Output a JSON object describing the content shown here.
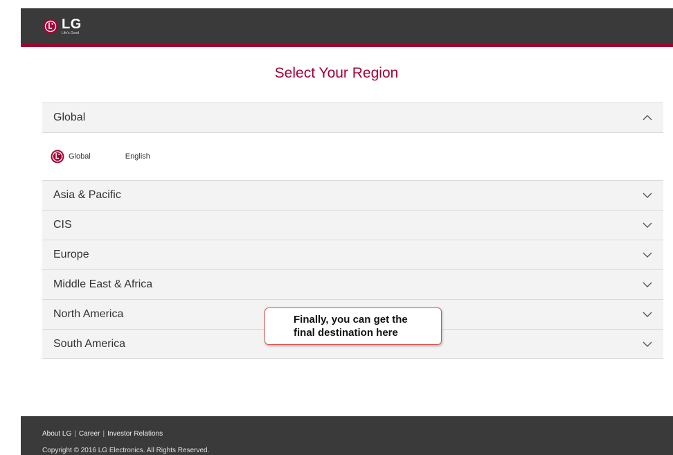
{
  "header": {
    "logo_text": "LG",
    "logo_tagline": "Life's Good",
    "brand_color": "#a50034"
  },
  "page": {
    "title": "Select Your Region"
  },
  "regions": [
    {
      "label": "Global",
      "expanded": true,
      "icon": "chevron-up-icon"
    },
    {
      "label": "Asia & Pacific",
      "expanded": false,
      "icon": "chevron-down-icon"
    },
    {
      "label": "CIS",
      "expanded": false,
      "icon": "chevron-down-icon"
    },
    {
      "label": "Europe",
      "expanded": false,
      "icon": "chevron-down-icon"
    },
    {
      "label": "Middle East & Africa",
      "expanded": false,
      "icon": "chevron-down-icon"
    },
    {
      "label": "North America",
      "expanded": false,
      "icon": "chevron-down-icon"
    },
    {
      "label": "South America",
      "expanded": false,
      "icon": "chevron-down-icon"
    }
  ],
  "global_sites": [
    {
      "site": "Global",
      "language": "English",
      "icon": "lg-logo-icon"
    }
  ],
  "callout": {
    "line1": "Finally, you can get the",
    "line2": "final destination here"
  },
  "footer": {
    "links": [
      "About LG",
      "Career",
      "Investor Relations"
    ],
    "separator": "|",
    "copyright": "Copyright © 2016 LG Electronics. All Rights Reserved."
  }
}
